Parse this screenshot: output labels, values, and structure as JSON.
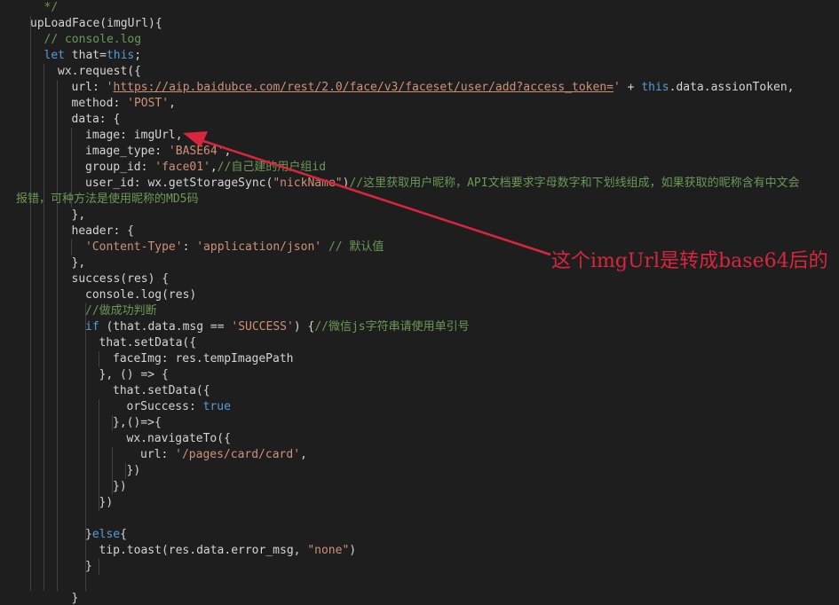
{
  "colors": {
    "background": "#1e1e1e",
    "default_text": "#d4d4d4",
    "comment": "#6a9955",
    "string": "#ce9178",
    "keyword": "#569cd6",
    "annotation": "#d7263d",
    "indent_guide": "#404040"
  },
  "code_lines": [
    [
      {
        "t": "*/",
        "c": "c"
      }
    ],
    [
      {
        "t": "upLoadFace(imgUrl){",
        "c": "p"
      }
    ],
    [
      {
        "t": "// console.log",
        "c": "c"
      }
    ],
    [
      {
        "t": "let",
        "c": "k"
      },
      {
        "t": " that=",
        "c": "p"
      },
      {
        "t": "this",
        "c": "k"
      },
      {
        "t": ";",
        "c": "p"
      }
    ],
    [
      {
        "t": "wx.request({",
        "c": "p"
      }
    ],
    [
      {
        "t": "url: ",
        "c": "p"
      },
      {
        "t": "'",
        "c": "s"
      },
      {
        "t": "https://aip.baidubce.com/rest/2.0/face/v3/faceset/user/add?access_token=",
        "c": "u"
      },
      {
        "t": "'",
        "c": "s"
      },
      {
        "t": " + ",
        "c": "p"
      },
      {
        "t": "this",
        "c": "k"
      },
      {
        "t": ".data.assionToken,",
        "c": "p"
      }
    ],
    [
      {
        "t": "method: ",
        "c": "p"
      },
      {
        "t": "'POST'",
        "c": "s"
      },
      {
        "t": ",",
        "c": "p"
      }
    ],
    [
      {
        "t": "data: {",
        "c": "p"
      }
    ],
    [
      {
        "t": "image: imgUrl,",
        "c": "p"
      }
    ],
    [
      {
        "t": "image_type: ",
        "c": "p"
      },
      {
        "t": "'BASE64'",
        "c": "s"
      },
      {
        "t": ",",
        "c": "p"
      }
    ],
    [
      {
        "t": "group_id: ",
        "c": "p"
      },
      {
        "t": "'face01'",
        "c": "s"
      },
      {
        "t": ",",
        "c": "p"
      },
      {
        "t": "//自己建的用户组id",
        "c": "c"
      }
    ],
    [
      {
        "t": "user_id: wx.getStorageSync(",
        "c": "p"
      },
      {
        "t": "\"nickName\"",
        "c": "s"
      },
      {
        "t": ")",
        "c": "p"
      },
      {
        "t": "//这里获取用户昵称，API文档要求字母数字和下划线组成，如果获取的昵称含有中文会",
        "c": "c"
      }
    ],
    [
      {
        "t": "报错，可种方法是使用昵称的MD5码",
        "c": "c"
      }
    ],
    [
      {
        "t": "},",
        "c": "p"
      }
    ],
    [
      {
        "t": "header: {",
        "c": "p"
      }
    ],
    [
      {
        "t": "'Content-Type'",
        "c": "s"
      },
      {
        "t": ": ",
        "c": "p"
      },
      {
        "t": "'application/json'",
        "c": "s"
      },
      {
        "t": " ",
        "c": "p"
      },
      {
        "t": "// 默认值",
        "c": "c"
      }
    ],
    [
      {
        "t": "},",
        "c": "p"
      }
    ],
    [
      {
        "t": "success(res) {",
        "c": "p"
      }
    ],
    [
      {
        "t": "console.log(res)",
        "c": "p"
      }
    ],
    [
      {
        "t": "//做成功判断",
        "c": "c"
      }
    ],
    [
      {
        "t": "if",
        "c": "k"
      },
      {
        "t": " (that.data.msg == ",
        "c": "p"
      },
      {
        "t": "'SUCCESS'",
        "c": "s"
      },
      {
        "t": ") {",
        "c": "p"
      },
      {
        "t": "//微信js字符串请使用单引号",
        "c": "c"
      }
    ],
    [
      {
        "t": "that.setData({",
        "c": "p"
      }
    ],
    [
      {
        "t": "faceImg: res.tempImagePath",
        "c": "p"
      }
    ],
    [
      {
        "t": "}, () => {",
        "c": "p"
      }
    ],
    [
      {
        "t": "that.setData({",
        "c": "p"
      }
    ],
    [
      {
        "t": "orSuccess: ",
        "c": "p"
      },
      {
        "t": "true",
        "c": "k"
      }
    ],
    [
      {
        "t": "},()=>{",
        "c": "p"
      }
    ],
    [
      {
        "t": "wx.navigateTo({",
        "c": "p"
      }
    ],
    [
      {
        "t": "url: ",
        "c": "p"
      },
      {
        "t": "'/pages/card/card'",
        "c": "s"
      },
      {
        "t": ",",
        "c": "p"
      }
    ],
    [
      {
        "t": "})",
        "c": "p"
      }
    ],
    [
      {
        "t": "})",
        "c": "p"
      }
    ],
    [
      {
        "t": "})",
        "c": "p"
      }
    ],
    [],
    [
      {
        "t": "}",
        "c": "p"
      },
      {
        "t": "else",
        "c": "k"
      },
      {
        "t": "{",
        "c": "p"
      }
    ],
    [
      {
        "t": "tip.toast(res.data.error_msg, ",
        "c": "p"
      },
      {
        "t": "\"none\"",
        "c": "s"
      },
      {
        "t": ")",
        "c": "p"
      }
    ],
    [
      {
        "t": "}",
        "c": "p"
      }
    ],
    [],
    [
      {
        "t": "}",
        "c": "p"
      }
    ]
  ],
  "annotation": {
    "text": "这个imgUrl是转成base64后的"
  }
}
